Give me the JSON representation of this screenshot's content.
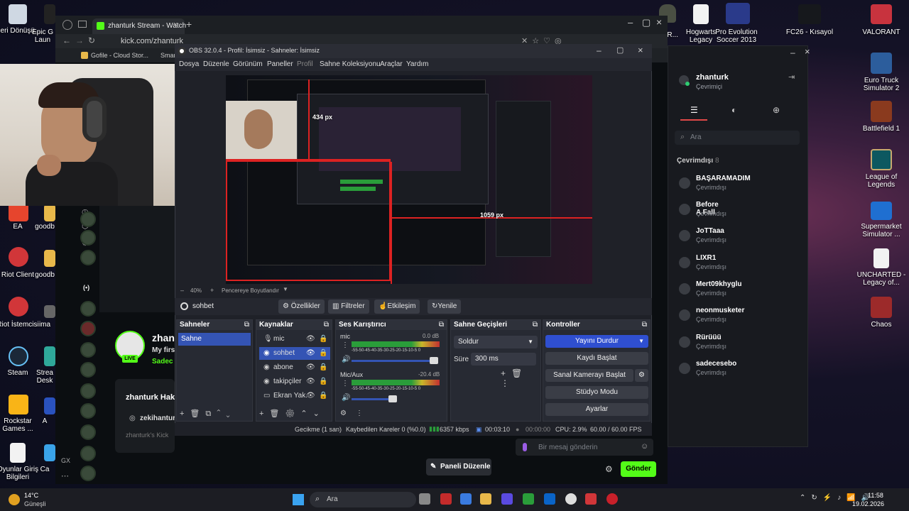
{
  "browser": {
    "tab_title": "zhanturk Stream - Watch",
    "url": "kick.com/zhanturk",
    "bookmarks": [
      "Gofile - Cloud Stor...",
      "Smar"
    ]
  },
  "kick": {
    "channel_initial": "zhan",
    "channel_sub": "My firs",
    "channel_sub2": "Sadec",
    "live_badge": "LIVE",
    "about_title": "zhanturk Hak",
    "instagram": "zekihantur",
    "about_text": "zhanturk's Kick",
    "chat_placeholder": "Bir mesaj gönderin",
    "send_label": "Gönder",
    "edit_panel_label": "Paneli Düzenle"
  },
  "obs": {
    "title": "OBS 32.0.4 - Profil: İsimsiz - Sahneler: İsimsiz",
    "menu": [
      "Dosya",
      "Düzenle",
      "Görünüm",
      "Paneller",
      "Profil",
      "Sahne Koleksiyonu",
      "Araçlar",
      "Yardım"
    ],
    "preview_labels": {
      "px1": "434 px",
      "px2": "1059 px"
    },
    "zoom": "40%",
    "fit_label": "Pencereye Boyutlandır",
    "current_source": "sohbet",
    "toolbar": {
      "props": "Özellikler",
      "filters": "Filtreler",
      "interact": "Etkileşim",
      "refresh": "Yenile"
    },
    "scenes": {
      "title": "Sahneler",
      "items": [
        "Sahne"
      ]
    },
    "sources": {
      "title": "Kaynaklar",
      "items": [
        "mic",
        "sohbet",
        "abone",
        "takipçiler",
        "Ekran Yak."
      ]
    },
    "mixer": {
      "title": "Ses Karıştırıcı",
      "channels": [
        {
          "name": "mic",
          "db": "0.0 dB"
        },
        {
          "name": "Mic/Aux",
          "db": "-20.4 dB"
        }
      ],
      "scale": "-55-50-45-40-35-30-25-20-15-10-5  0"
    },
    "transitions": {
      "title": "Sahne Geçişleri",
      "type": "Soldur",
      "duration_label": "Süre",
      "duration": "300 ms"
    },
    "controls": {
      "title": "Kontroller",
      "stop_stream": "Yayını Durdur",
      "start_record": "Kaydı Başlat",
      "virtual_cam": "Sanal Kamerayı Başlat",
      "studio": "Stüdyo Modu",
      "settings": "Ayarlar"
    },
    "status": {
      "delay": "Gecikme (1 san)",
      "dropped": "Kaybedilen Kareler 0 (%0.0)",
      "bitrate": "6357 kbps",
      "stream_time": "00:03:10",
      "rec_time": "00:00:00",
      "cpu": "CPU: 2.9%",
      "fps": "60.00 / 60.00 FPS"
    }
  },
  "friends_panel": {
    "user": "zhanturk",
    "user_status": "Çevrimiçi",
    "search_placeholder": "Ara",
    "offline_header": "Çevrimdışı",
    "offline_count": "8",
    "friends": [
      {
        "name": "BAŞARAMADIM",
        "status": "Çevrimdışı"
      },
      {
        "name": "Before A Fall",
        "status": "Çevrimdışı"
      },
      {
        "name": "JoTTaaa",
        "status": "Çevrimdışı"
      },
      {
        "name": "LIXR1",
        "status": "Çevrimdışı"
      },
      {
        "name": "Mert09khyglu",
        "status": "Çevrimdışı"
      },
      {
        "name": "neonmusketer",
        "status": "Çevrimdışı"
      },
      {
        "name": "Rürüüü",
        "status": "Çevrimdışı"
      },
      {
        "name": "sadecesebo",
        "status": "Çevrimdışı"
      }
    ]
  },
  "desktop_left": [
    {
      "label": "Geri Dönüşü...",
      "color": "#cfd8e3"
    },
    {
      "label": "EA",
      "color": "#e6452d"
    },
    {
      "label": "Riot Client",
      "color": "#d13639"
    },
    {
      "label": "Riot İstemcisi",
      "color": "#d13639"
    },
    {
      "label": "Steam",
      "color": "#1b2838"
    },
    {
      "label": "Rockstar Games ...",
      "color": "#f9b417"
    },
    {
      "label": "Oyunlar Giriş Bilgileri",
      "color": "#f2f2f2"
    }
  ],
  "desktop_col2": [
    {
      "label": "Epic G Laun"
    },
    {
      "label": "goodb"
    },
    {
      "label": "goodb"
    },
    {
      "label": "ima"
    },
    {
      "label": "Strea Desk"
    },
    {
      "label": "A"
    },
    {
      "label": "Ca"
    }
  ],
  "desktop_top": [
    {
      "label": "EGR..."
    },
    {
      "label": "Hogwarts Legacy"
    },
    {
      "label": "Pro Evolution Soccer 2013"
    },
    {
      "label": "FC26 - Kısayol"
    },
    {
      "label": "VALORANT"
    }
  ],
  "desktop_right": [
    {
      "label": "Euro Truck Simulator 2",
      "color": "#2c5d9c"
    },
    {
      "label": "Battlefield 1",
      "color": "#8a3a1e"
    },
    {
      "label": "League of Legends",
      "color": "#0d5860"
    },
    {
      "label": "Supermarket Simulator ...",
      "color": "#1f6fd1"
    },
    {
      "label": "UNCHARTED - Legacy of...",
      "color": "#f2f2f2"
    },
    {
      "label": "Chaos",
      "color": "#9c2a2a"
    }
  ],
  "taskbar": {
    "weather_temp": "14°C",
    "weather_text": "Güneşli",
    "search": "Ara",
    "time": "11:58",
    "date": "19.02.2026"
  },
  "colors": {
    "obs_accent": "#3454b4",
    "kick_green": "#53fc18",
    "stop_btn": "#2f4fd0"
  }
}
